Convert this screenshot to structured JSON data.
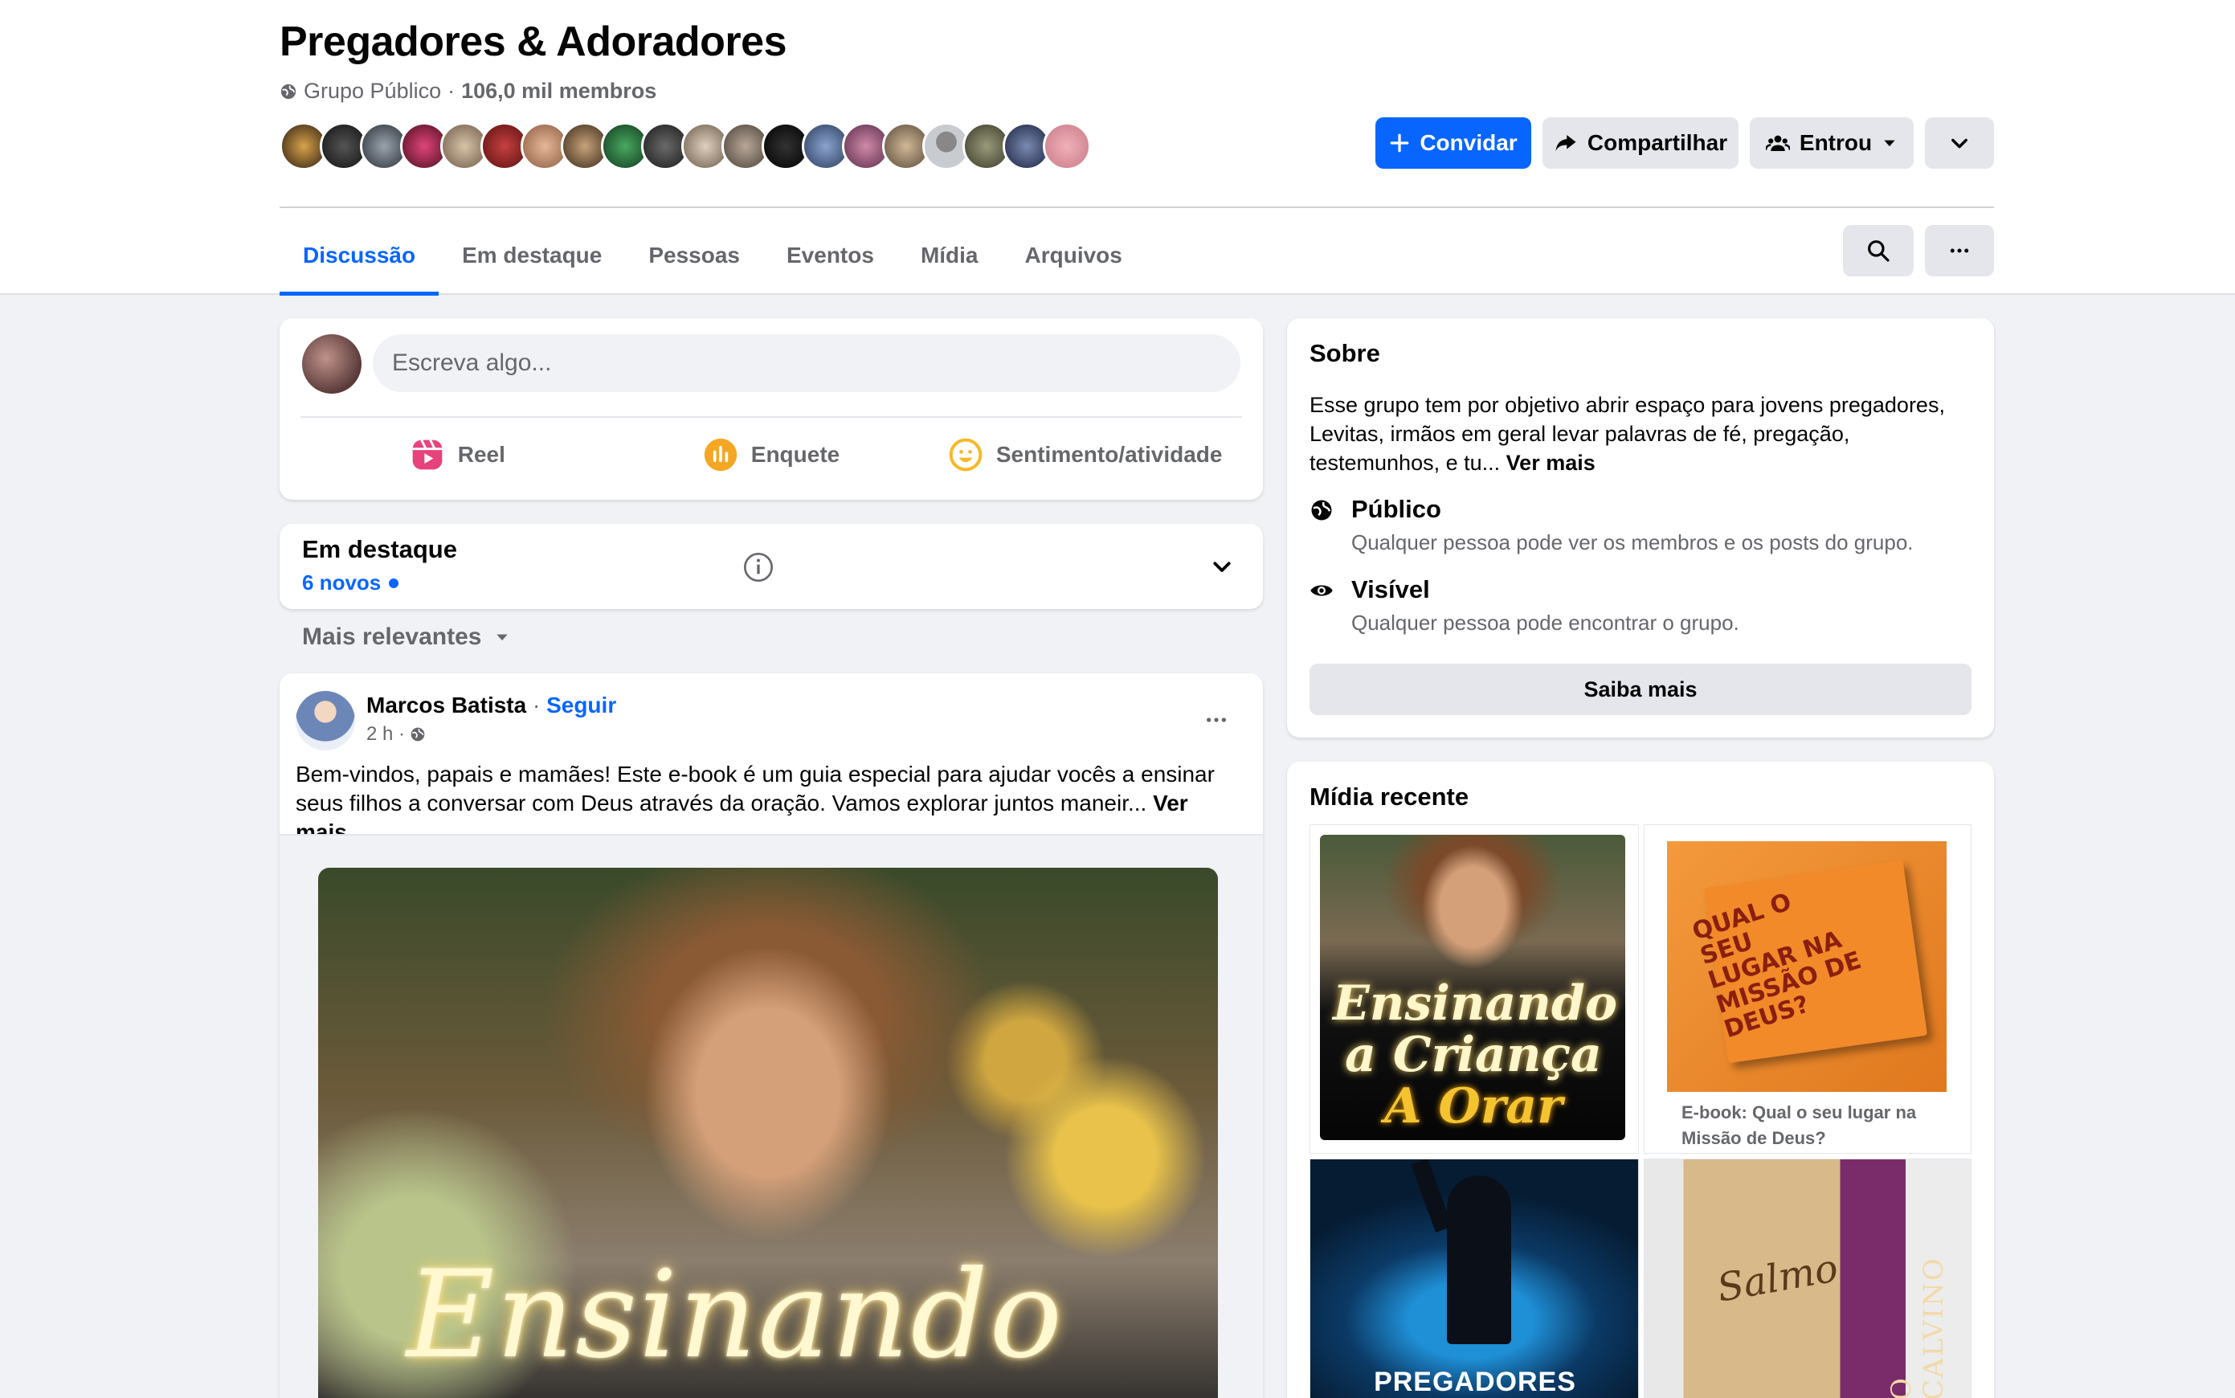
{
  "group": {
    "title": "Pregadores & Adoradores",
    "privacy": "Grupo Público",
    "separator": "·",
    "members": "106,0 mil membros"
  },
  "header_buttons": {
    "invite": "Convidar",
    "share": "Compartilhar",
    "joined": "Entrou"
  },
  "tabs": [
    "Discussão",
    "Em destaque",
    "Pessoas",
    "Eventos",
    "Mídia",
    "Arquivos"
  ],
  "composer": {
    "placeholder": "Escreva algo...",
    "actions": [
      "Reel",
      "Enquete",
      "Sentimento/atividade"
    ]
  },
  "featured": {
    "title": "Em destaque",
    "new_count": "6 novos"
  },
  "sort": {
    "label": "Mais relevantes"
  },
  "post": {
    "author": "Marcos Batista",
    "separator": "·",
    "follow": "Seguir",
    "time": "2 h ·",
    "text": "Bem-vindos, papais e mamães! Este e-book é um guia especial para ajudar vocês a ensinar seus filhos a conversar com Deus através da oração. Vamos explorar juntos maneir...",
    "see_more": "Ver mais",
    "image_text": "Ensinando"
  },
  "about": {
    "title": "Sobre",
    "description": "Esse grupo tem por objetivo abrir espaço para jovens pregadores, Levitas, irmãos em geral levar palavras de fé, pregação, testemunhos, e tu...",
    "see_more": "Ver mais",
    "public_title": "Público",
    "public_sub": "Qualquer pessoa pode ver os membros e os posts do grupo.",
    "visible_title": "Visível",
    "visible_sub": "Qualquer pessoa pode encontrar o grupo.",
    "learn_more": "Saiba mais"
  },
  "recent_media": {
    "title": "Mídia recente",
    "tile1_line1": "Ensinando",
    "tile1_line2": "a Criança",
    "tile1_line3": "A Orar",
    "tile2_book_text": "QUAL O SEU LUGAR NA MISSÃO DE DEUS?",
    "tile2_caption": "E-book: Qual o seu lugar na Missão de Deus?",
    "tile3_text": "PREGADORES",
    "tile4_spine": "O CALVINO",
    "tile4_cover": "Salmo"
  },
  "colors": {
    "accent": "#0866ff",
    "background": "#f0f2f5",
    "secondary_text": "#65676b",
    "button_gray": "#e4e6eb"
  }
}
